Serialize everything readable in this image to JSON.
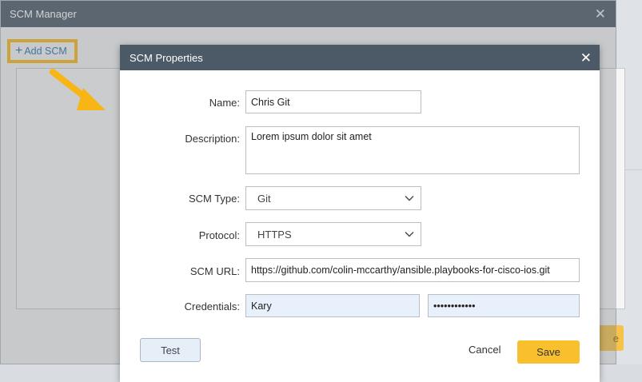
{
  "manager": {
    "title": "SCM Manager",
    "close_glyph": "✕",
    "add_label": "Add SCM",
    "add_icon": "plus-icon",
    "save_peek": "e"
  },
  "dialog": {
    "title": "SCM Properties",
    "close_glyph": "✕",
    "fields": {
      "name": {
        "label": "Name:",
        "value": "Chris Git"
      },
      "description": {
        "label": "Description:",
        "value": "Lorem ipsum dolor sit amet"
      },
      "scm_type": {
        "label": "SCM Type:",
        "value": "Git"
      },
      "protocol": {
        "label": "Protocol:",
        "value": "HTTPS"
      },
      "scm_url": {
        "label": "SCM URL:",
        "value": "https://github.com/colin-mccarthy/ansible.playbooks-for-cisco-ios.git"
      },
      "credentials": {
        "label": "Credentials:",
        "username": "Kary",
        "password": "••••••••••••"
      }
    },
    "buttons": {
      "test": "Test",
      "cancel": "Cancel",
      "save": "Save"
    }
  },
  "colors": {
    "titlebar": "#4c5a67",
    "highlight": "#f8b516",
    "save": "#f9c02e",
    "link": "#2a6fb0"
  }
}
